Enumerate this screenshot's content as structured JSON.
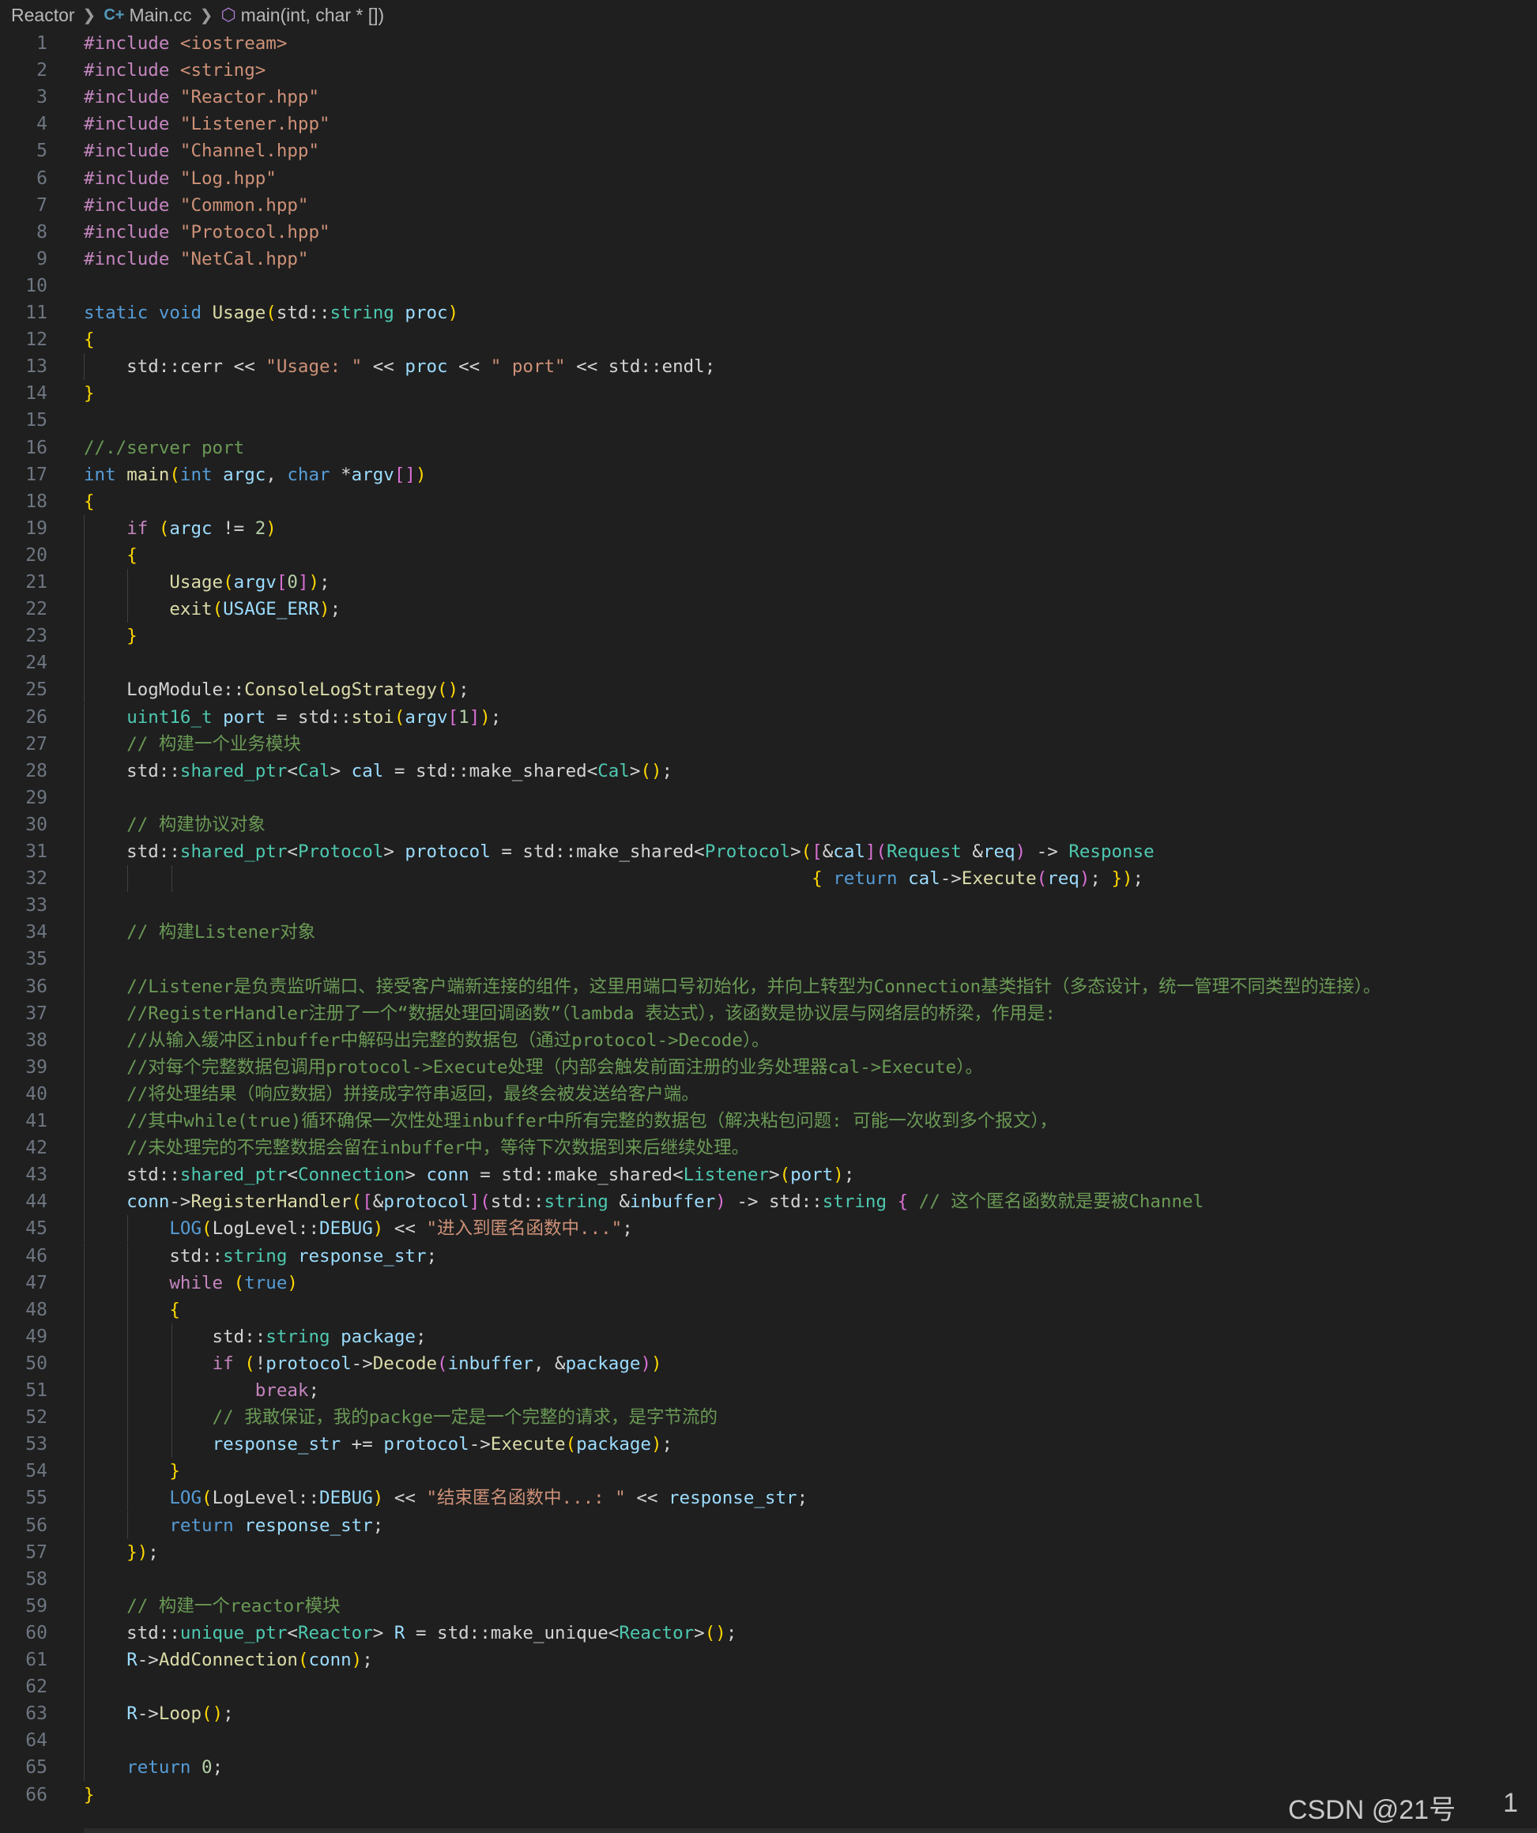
{
  "breadcrumb": {
    "folder": "Reactor",
    "file": "Main.cc",
    "symbol": "main(int, char * [])"
  },
  "lines": [
    {
      "n": "1",
      "text": "#include <iostream>"
    },
    {
      "n": "2",
      "text": "#include <string>"
    },
    {
      "n": "3",
      "text": "#include \"Reactor.hpp\""
    },
    {
      "n": "4",
      "text": "#include \"Listener.hpp\""
    },
    {
      "n": "5",
      "text": "#include \"Channel.hpp\""
    },
    {
      "n": "6",
      "text": "#include \"Log.hpp\""
    },
    {
      "n": "7",
      "text": "#include \"Common.hpp\""
    },
    {
      "n": "8",
      "text": "#include \"Protocol.hpp\""
    },
    {
      "n": "9",
      "text": "#include \"NetCal.hpp\""
    },
    {
      "n": "10",
      "text": ""
    },
    {
      "n": "11",
      "text": "static void Usage(std::string proc)"
    },
    {
      "n": "12",
      "text": "{"
    },
    {
      "n": "13",
      "text": "    std::cerr << \"Usage: \" << proc << \" port\" << std::endl;"
    },
    {
      "n": "14",
      "text": "}"
    },
    {
      "n": "15",
      "text": ""
    },
    {
      "n": "16",
      "text": "//./server port"
    },
    {
      "n": "17",
      "text": "int main(int argc, char *argv[])"
    },
    {
      "n": "18",
      "text": "{"
    },
    {
      "n": "19",
      "text": "    if (argc != 2)"
    },
    {
      "n": "20",
      "text": "    {"
    },
    {
      "n": "21",
      "text": "        Usage(argv[0]);"
    },
    {
      "n": "22",
      "text": "        exit(USAGE_ERR);"
    },
    {
      "n": "23",
      "text": "    }"
    },
    {
      "n": "24",
      "text": ""
    },
    {
      "n": "25",
      "text": "    LogModule::ConsoleLogStrategy();"
    },
    {
      "n": "26",
      "text": "    uint16_t port = std::stoi(argv[1]);"
    },
    {
      "n": "27",
      "text": "    // 构建一个业务模块"
    },
    {
      "n": "28",
      "text": "    std::shared_ptr<Cal> cal = std::make_shared<Cal>();"
    },
    {
      "n": "29",
      "text": ""
    },
    {
      "n": "30",
      "text": "    // 构建协议对象"
    },
    {
      "n": "31",
      "text": "    std::shared_ptr<Protocol> protocol = std::make_shared<Protocol>([&cal](Request &req) -> Response"
    },
    {
      "n": "32",
      "text": "                                                                    { return cal->Execute(req); });"
    },
    {
      "n": "33",
      "text": ""
    },
    {
      "n": "34",
      "text": "    // 构建Listener对象"
    },
    {
      "n": "35",
      "text": ""
    },
    {
      "n": "36",
      "text": "    //Listener是负责监听端口、接受客户端新连接的组件，这里用端口号初始化，并向上转型为Connection基类指针（多态设计，统一管理不同类型的连接）。"
    },
    {
      "n": "37",
      "text": "    //RegisterHandler注册了一个“数据处理回调函数”（lambda 表达式），该函数是协议层与网络层的桥梁，作用是:"
    },
    {
      "n": "38",
      "text": "    //从输入缓冲区inbuffer中解码出完整的数据包（通过protocol->Decode）。"
    },
    {
      "n": "39",
      "text": "    //对每个完整数据包调用protocol->Execute处理（内部会触发前面注册的业务处理器cal->Execute）。"
    },
    {
      "n": "40",
      "text": "    //将处理结果（响应数据）拼接成字符串返回，最终会被发送给客户端。"
    },
    {
      "n": "41",
      "text": "    //其中while(true)循环确保一次性处理inbuffer中所有完整的数据包（解决粘包问题: 可能一次收到多个报文），"
    },
    {
      "n": "42",
      "text": "    //未处理完的不完整数据会留在inbuffer中，等待下次数据到来后继续处理。"
    },
    {
      "n": "43",
      "text": "    std::shared_ptr<Connection> conn = std::make_shared<Listener>(port);"
    },
    {
      "n": "44",
      "text": "    conn->RegisterHandler([&protocol](std::string &inbuffer) -> std::string { // 这个匿名函数就是要被Channel"
    },
    {
      "n": "45",
      "text": "        LOG(LogLevel::DEBUG) << \"进入到匿名函数中...\";"
    },
    {
      "n": "46",
      "text": "        std::string response_str;"
    },
    {
      "n": "47",
      "text": "        while (true)"
    },
    {
      "n": "48",
      "text": "        {"
    },
    {
      "n": "49",
      "text": "            std::string package;"
    },
    {
      "n": "50",
      "text": "            if (!protocol->Decode(inbuffer, &package))"
    },
    {
      "n": "51",
      "text": "                break;"
    },
    {
      "n": "52",
      "text": "            // 我敢保证，我的packge一定是一个完整的请求，是字节流的"
    },
    {
      "n": "53",
      "text": "            response_str += protocol->Execute(package);"
    },
    {
      "n": "54",
      "text": "        }"
    },
    {
      "n": "55",
      "text": "        LOG(LogLevel::DEBUG) << \"结束匿名函数中...: \" << response_str;"
    },
    {
      "n": "56",
      "text": "        return response_str;"
    },
    {
      "n": "57",
      "text": "    });"
    },
    {
      "n": "58",
      "text": ""
    },
    {
      "n": "59",
      "text": "    // 构建一个reactor模块"
    },
    {
      "n": "60",
      "text": "    std::unique_ptr<Reactor> R = std::make_unique<Reactor>();"
    },
    {
      "n": "61",
      "text": "    R->AddConnection(conn);"
    },
    {
      "n": "62",
      "text": ""
    },
    {
      "n": "63",
      "text": "    R->Loop();"
    },
    {
      "n": "64",
      "text": ""
    },
    {
      "n": "65",
      "text": "    return 0;"
    },
    {
      "n": "66",
      "text": "}"
    }
  ],
  "watermark": {
    "text": "CSDN @21号",
    "page_fragment": "1"
  },
  "colors": {
    "background": "#1f1f1f",
    "line_number": "#6e7681",
    "keyword": "#569cd6",
    "control": "#c586c0",
    "type": "#4ec9b0",
    "function": "#dcdcaa",
    "string": "#ce9178",
    "comment": "#6a9955",
    "number": "#b5cea8",
    "variable": "#9cdcfe"
  }
}
